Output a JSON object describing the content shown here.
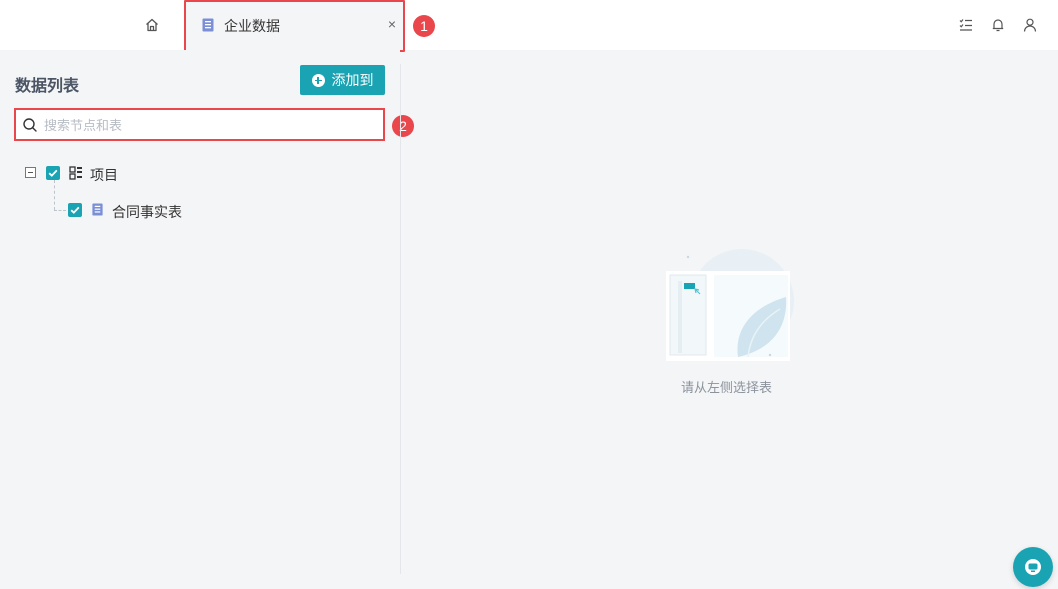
{
  "tab": {
    "label": "企业数据",
    "close_glyph": "×"
  },
  "annotations": [
    {
      "number": "1"
    },
    {
      "number": "2"
    }
  ],
  "panel": {
    "title": "数据列表",
    "add_button_label": "添加到",
    "search_placeholder": "搜索节点和表"
  },
  "tree": [
    {
      "label": "项目",
      "checked": true,
      "icon": "grid-icon",
      "expanded": true
    },
    {
      "label": "合同事实表",
      "checked": true,
      "icon": "table-doc-icon"
    }
  ],
  "empty_state": {
    "text": "请从左侧选择表"
  },
  "colors": {
    "accent": "#1aa3b3",
    "annotation": "#e9474b",
    "background": "#f4f5f7"
  },
  "icons": {
    "home": "home-icon",
    "tasks": "checklist-icon",
    "notifications": "bell-icon",
    "user": "user-icon",
    "help": "chat-help-icon"
  }
}
